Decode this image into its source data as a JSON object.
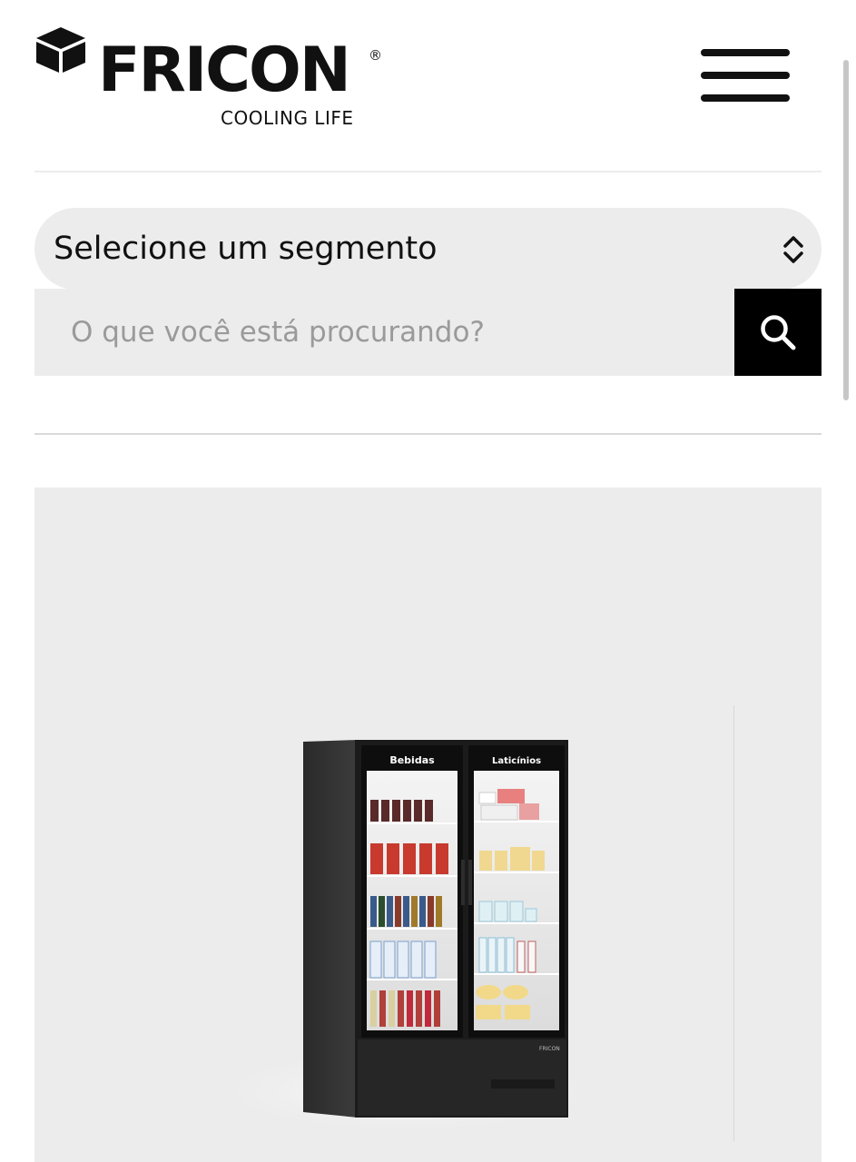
{
  "brand": {
    "name": "FRICON",
    "registered": "®",
    "tagline": "COOLING LIFE"
  },
  "segment": {
    "label": "Selecione um segmento"
  },
  "search": {
    "placeholder": "O que você está procurando?"
  },
  "product": {
    "door_labels": [
      "Bebidas",
      "Laticínios"
    ],
    "badge": "FRICON"
  },
  "icons": {
    "logo": "cube-icon",
    "menu": "hamburger-icon",
    "select": "chevron-updown-icon",
    "search": "search-icon"
  },
  "colors": {
    "text": "#111111",
    "field_bg": "#ececec",
    "button_bg": "#000000",
    "placeholder": "#9a9a9a"
  }
}
